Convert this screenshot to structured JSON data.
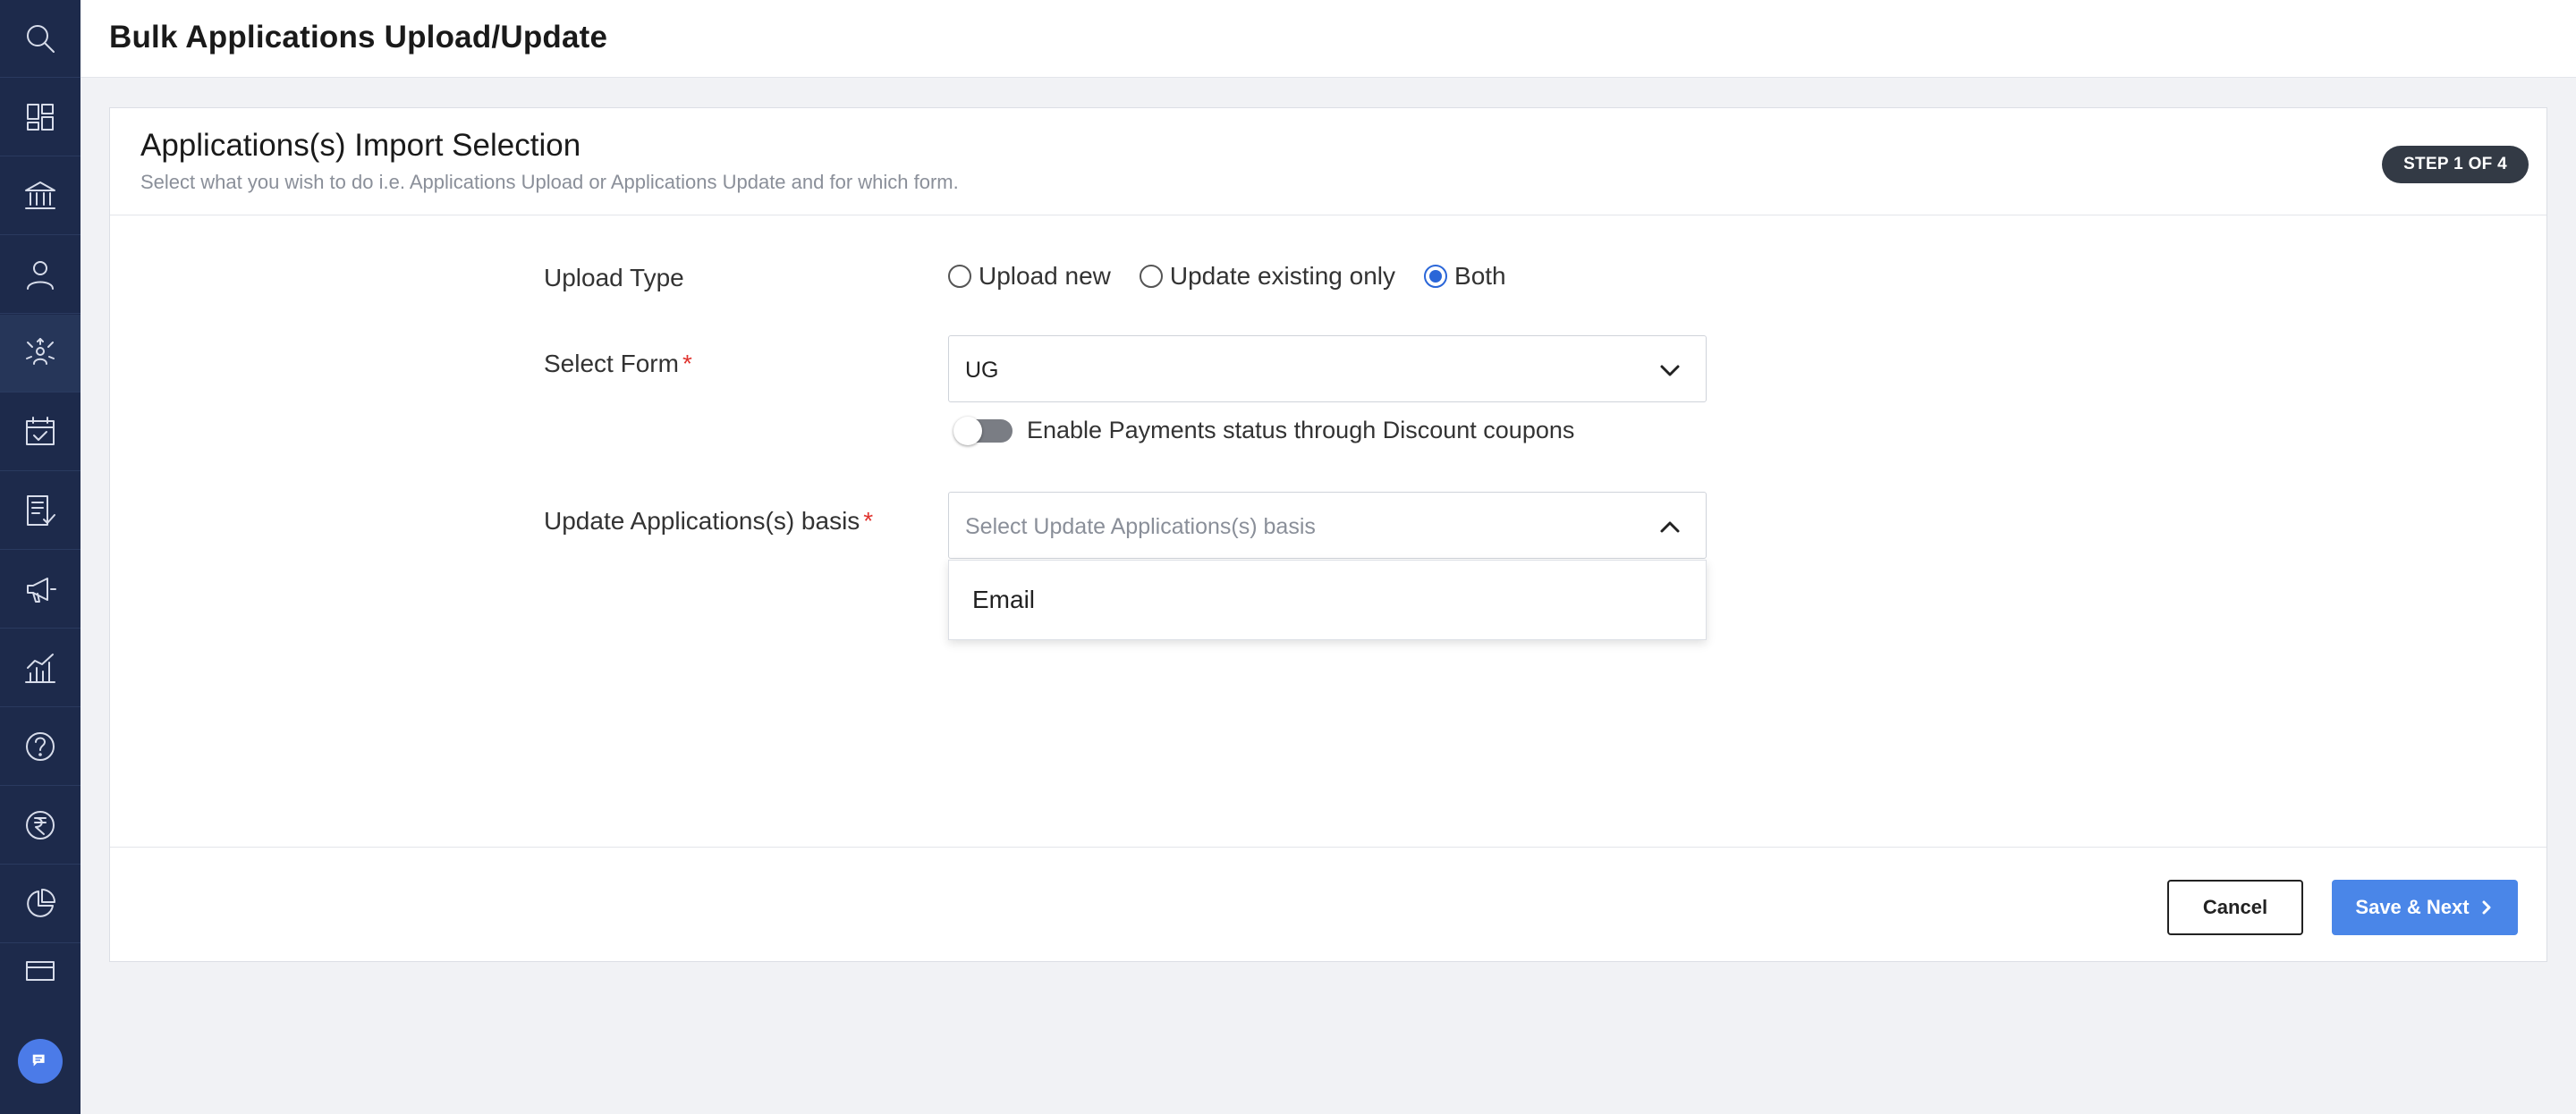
{
  "sidebar": {
    "items": [
      {
        "icon": "search-icon"
      },
      {
        "icon": "dashboard-icon"
      },
      {
        "icon": "institution-icon"
      },
      {
        "icon": "user-icon"
      },
      {
        "icon": "network-icon"
      },
      {
        "icon": "calendar-check-icon"
      },
      {
        "icon": "checklist-icon"
      },
      {
        "icon": "megaphone-icon"
      },
      {
        "icon": "analytics-icon"
      },
      {
        "icon": "help-icon"
      },
      {
        "icon": "rupee-icon"
      },
      {
        "icon": "pie-chart-icon"
      },
      {
        "icon": "card-icon"
      }
    ],
    "chat_icon": "chat-icon"
  },
  "header": {
    "title": "Bulk Applications Upload/Update"
  },
  "card": {
    "title": "Applications(s) Import Selection",
    "subtitle": "Select what you wish to do i.e. Applications Upload or Applications Update and for which form.",
    "step": "STEP 1 OF 4"
  },
  "form": {
    "upload_type": {
      "label": "Upload Type",
      "options": [
        "Upload new",
        "Update existing only",
        "Both"
      ],
      "selected": "Both"
    },
    "select_form": {
      "label": "Select Form",
      "required_mark": "*",
      "value": "UG"
    },
    "payments_toggle": {
      "label": "Enable Payments status through Discount coupons",
      "enabled": false
    },
    "update_basis": {
      "label": "Update Applications(s) basis",
      "required_mark": "*",
      "placeholder": "Select Update Applications(s) basis",
      "options": [
        "Email"
      ]
    }
  },
  "footer": {
    "cancel_label": "Cancel",
    "save_label": "Save & Next"
  },
  "colors": {
    "sidebar_bg": "#1d2a4b",
    "accent": "#4a86e8",
    "required": "#e0342f"
  }
}
